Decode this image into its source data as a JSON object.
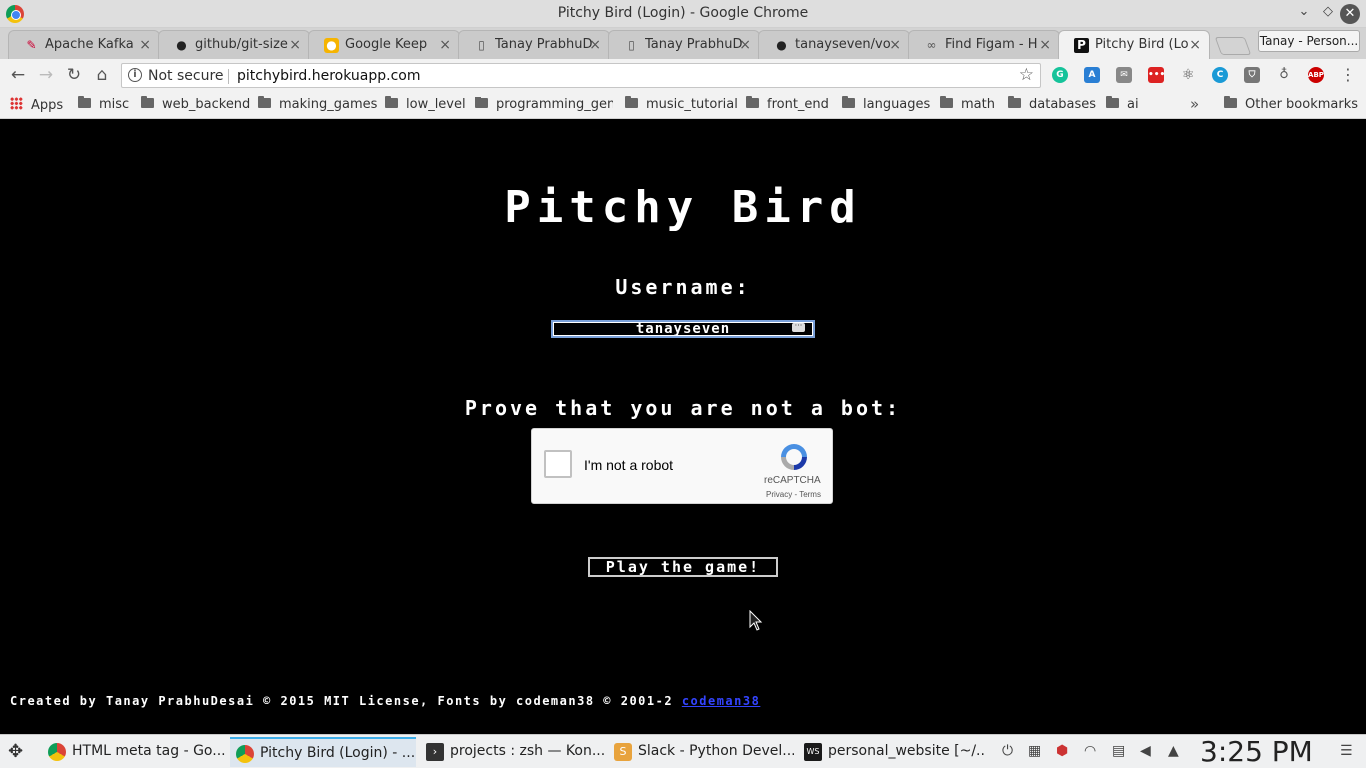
{
  "window": {
    "title": "Pitchy Bird (Login) - Google Chrome"
  },
  "tabs": [
    {
      "label": "Apache Kafka",
      "icon": "kafka-icon"
    },
    {
      "label": "github/git-size",
      "icon": "github-icon"
    },
    {
      "label": "Google Keep",
      "icon": "keep-icon"
    },
    {
      "label": "Tanay PrabhuD",
      "icon": "document-icon"
    },
    {
      "label": "Tanay PrabhuD",
      "icon": "document-icon"
    },
    {
      "label": "tanayseven/vo",
      "icon": "github-icon"
    },
    {
      "label": "Find Figam - H",
      "icon": "link-icon"
    },
    {
      "label": "Pitchy Bird (Lo",
      "icon": "pitchy-icon"
    }
  ],
  "profile": {
    "label": "Tanay - Person..."
  },
  "omnibox": {
    "security": "Not secure",
    "url": "pitchybird.herokuapp.com"
  },
  "bookmarks": {
    "apps": "Apps",
    "items": [
      "misc",
      "web_backend",
      "making_games",
      "low_level",
      "programming_gen",
      "music_tutorial",
      "front_end",
      "languages",
      "math",
      "databases",
      "ai"
    ],
    "other": "Other bookmarks"
  },
  "game": {
    "title": "Pitchy Bird",
    "username_label": "Username:",
    "username_value": "tanayseven",
    "bot_label": "Prove that you are not a bot:",
    "captcha_text": "I'm not a robot",
    "captcha_brand": "reCAPTCHA",
    "captcha_terms": "Privacy - Terms",
    "play_button": "Play the game!",
    "footer_text": "Created by Tanay PrabhuDesai © 2015 MIT License, Fonts by codeman38 © 2001-2",
    "footer_link": "codeman38"
  },
  "taskbar": {
    "tasks": [
      {
        "label": "HTML meta tag - Go...",
        "icon": "chrome-icon"
      },
      {
        "label": "Pitchy Bird (Login) - ...",
        "icon": "chrome-icon"
      },
      {
        "label": "projects : zsh — Kon...",
        "icon": "terminal-icon"
      },
      {
        "label": "Slack - Python Devel...",
        "icon": "slack-icon"
      },
      {
        "label": "personal_website [~/...",
        "icon": "webstorm-icon"
      }
    ],
    "clock": "3:25 PM"
  },
  "colors": {
    "page_bg": "#000000",
    "text": "#ffffff",
    "link": "#3344ff",
    "input_border": "#7aa0d8"
  }
}
